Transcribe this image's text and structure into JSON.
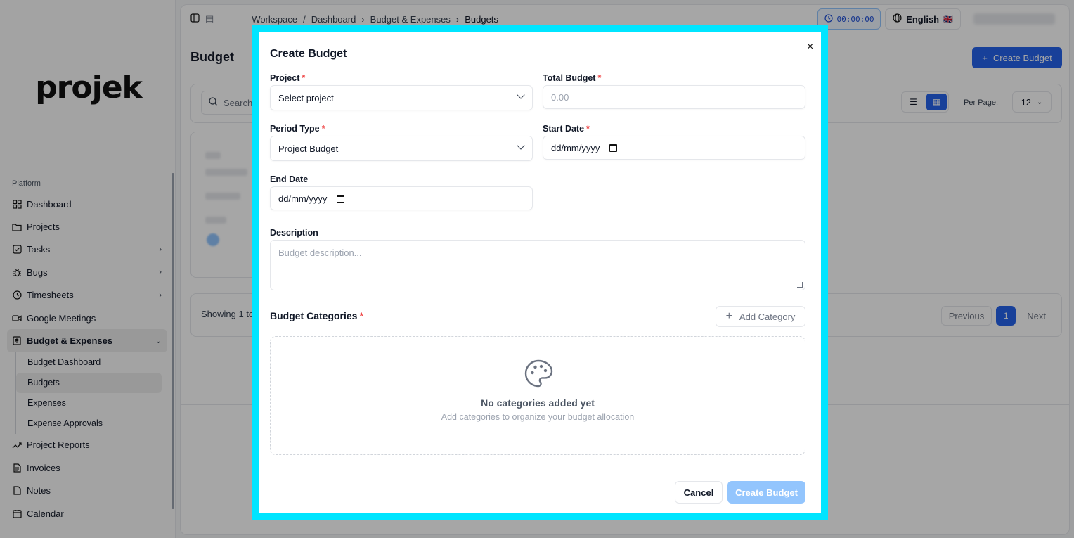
{
  "sidebar": {
    "logo": "projek",
    "section": "Platform",
    "items": [
      {
        "label": "Dashboard"
      },
      {
        "label": "Projects"
      },
      {
        "label": "Tasks"
      },
      {
        "label": "Bugs"
      },
      {
        "label": "Timesheets"
      },
      {
        "label": "Google Meetings"
      },
      {
        "label": "Budget & Expenses"
      },
      {
        "label": "Project Reports"
      },
      {
        "label": "Invoices"
      },
      {
        "label": "Notes"
      },
      {
        "label": "Calendar"
      }
    ],
    "budget_sub": [
      "Budget Dashboard",
      "Budgets",
      "Expenses",
      "Expense Approvals"
    ]
  },
  "header": {
    "breadcrumb": [
      "Workspace",
      "Dashboard",
      "Budget & Expenses",
      "Budgets"
    ],
    "timer": "00:00:00",
    "language": "English",
    "flag": "🇬🇧"
  },
  "page": {
    "title": "Budget",
    "create_button": "Create Budget",
    "search_placeholder": "Search",
    "per_page_label": "Per Page:",
    "per_page": "12",
    "showing": "Showing 1 to",
    "pagination": {
      "previous": "Previous",
      "current": "1",
      "next": "Next"
    }
  },
  "modal": {
    "title": "Create Budget",
    "close": "×",
    "project_label": "Project",
    "project_value": "Select project",
    "total_label": "Total Budget",
    "total_placeholder": "0.00",
    "period_label": "Period Type",
    "period_value": "Project Budget",
    "start_label": "Start Date",
    "start_value": "dd/mm/yyyy",
    "end_label": "End Date",
    "end_value": "dd/mm/yyyy",
    "desc_label": "Description",
    "desc_placeholder": "Budget description...",
    "categories_label": "Budget Categories",
    "add_category": "Add Category",
    "empty_title": "No categories added yet",
    "empty_sub": "Add categories to organize your budget allocation",
    "cancel": "Cancel",
    "submit": "Create Budget",
    "required_mark": "*"
  },
  "colors": {
    "primary": "#2563eb",
    "primary_disabled": "#93c5fd",
    "highlight_frame": "#00e5ff",
    "required": "#ef4444"
  }
}
